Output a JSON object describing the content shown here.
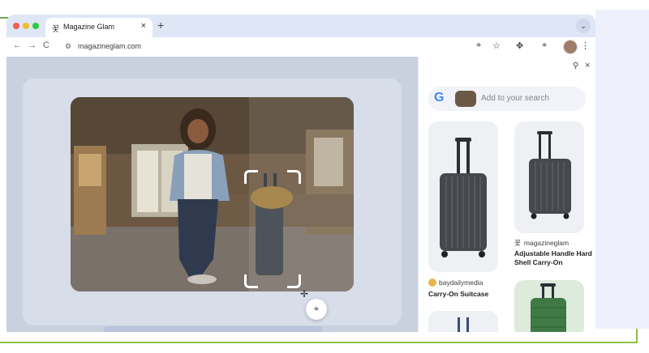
{
  "tab": {
    "title": "Magazine Glam",
    "favicon": "magazine-favicon",
    "close": "×"
  },
  "tabstrip": {
    "new_tab": "+",
    "dropdown": "⌄"
  },
  "toolbar": {
    "back": "←",
    "forward": "→",
    "reload": "C",
    "url": "magazineglam.com",
    "site_icon": "⚙",
    "lens": "⌖",
    "star": "☆",
    "extensions": "✥",
    "lens2": "⌖",
    "menu": "⋮"
  },
  "side_panel": {
    "pin": "⚲",
    "close": "×",
    "search_placeholder": "Add to your search",
    "google_logo": "G",
    "results": [
      {
        "source": "baydailymedia",
        "title": "Carry-On Suitcase"
      },
      {
        "source": "magazineglam",
        "title": "Adjustable Handle Hard Shell Carry-On"
      }
    ]
  },
  "lens_button": {
    "icon": "⌖"
  },
  "colors": {
    "accent": "#8bc34a",
    "browser_frame": "#dfe6f5",
    "luggage_dark": "#3a3d42",
    "luggage_green": "#3f7a44"
  }
}
